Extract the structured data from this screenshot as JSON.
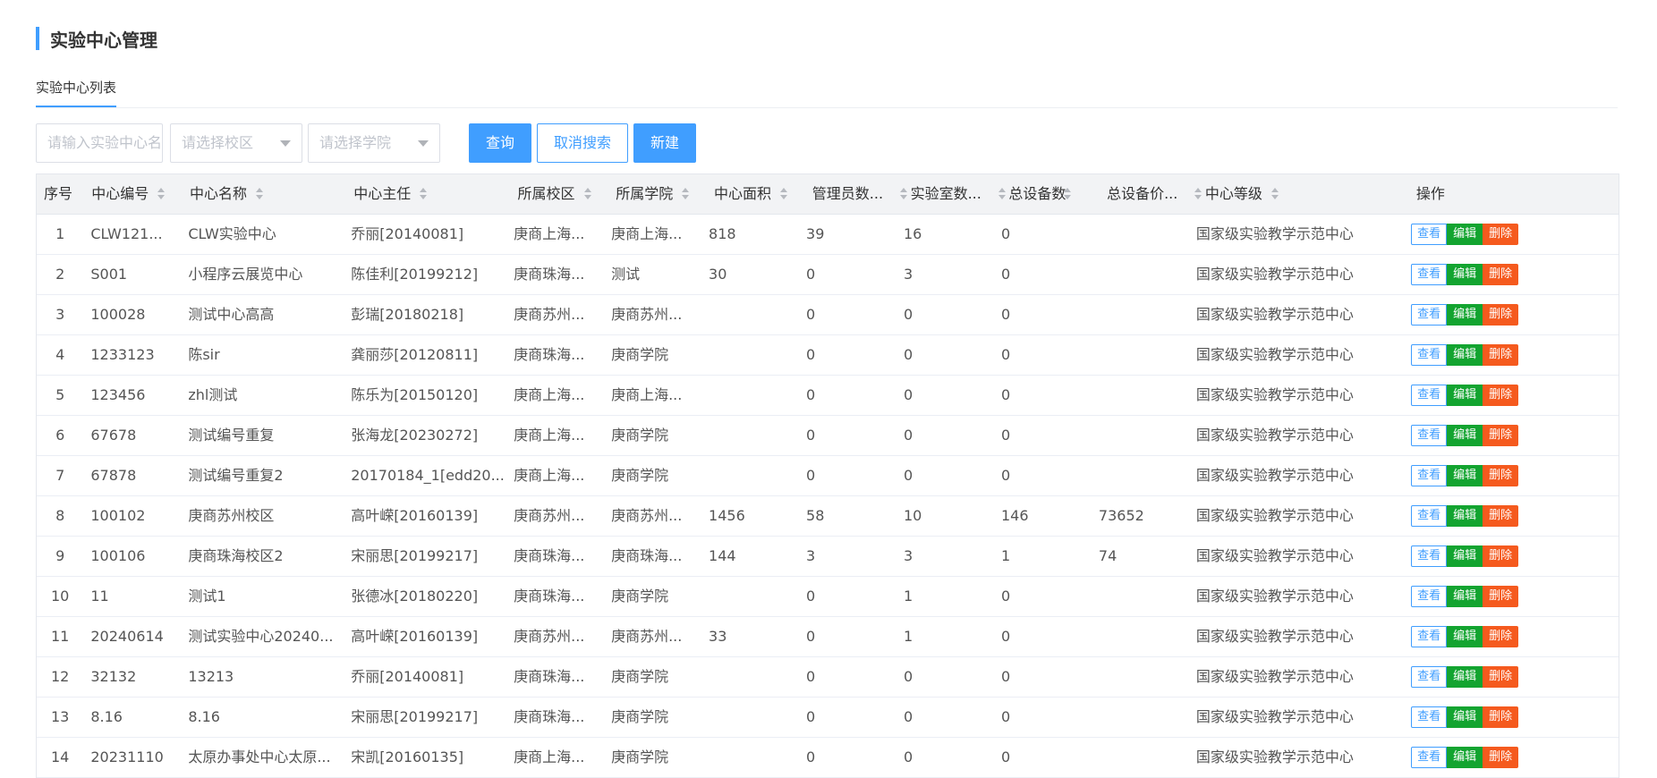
{
  "page": {
    "title": "实验中心管理"
  },
  "tabs": [
    {
      "label": "实验中心列表"
    }
  ],
  "toolbar": {
    "name_placeholder": "请输入实验中心名称",
    "campus_placeholder": "请选择校区",
    "college_placeholder": "请选择学院",
    "query_label": "查询",
    "cancel_label": "取消搜索",
    "new_label": "新建"
  },
  "table": {
    "headers": [
      "序号",
      "中心编号",
      "中心名称",
      "中心主任",
      "所属校区",
      "所属学院",
      "中心面积",
      "管理员数...",
      "实验室数...",
      "总设备数",
      "总设备价...",
      "中心等级",
      "操作"
    ],
    "action_labels": {
      "view": "查看",
      "edit": "编辑",
      "delete": "删除"
    },
    "rows": [
      [
        "1",
        "CLW121...",
        "CLW实验中心",
        "乔丽[20140081]",
        "庚商上海...",
        "庚商上海...",
        "818",
        "39",
        "16",
        "0",
        "",
        "国家级实验教学示范中心"
      ],
      [
        "2",
        "S001",
        "小程序云展览中心",
        "陈佳利[20199212]",
        "庚商珠海...",
        "测试",
        "30",
        "0",
        "3",
        "0",
        "",
        "国家级实验教学示范中心"
      ],
      [
        "3",
        "100028",
        "测试中心高高",
        "彭瑞[20180218]",
        "庚商苏州...",
        "庚商苏州...",
        "",
        "0",
        "0",
        "0",
        "",
        "国家级实验教学示范中心"
      ],
      [
        "4",
        "1233123",
        "陈sir",
        "龚丽莎[20120811]",
        "庚商珠海...",
        "庚商学院",
        "",
        "0",
        "0",
        "0",
        "",
        "国家级实验教学示范中心"
      ],
      [
        "5",
        "123456",
        "zhl测试",
        "陈乐为[20150120]",
        "庚商上海...",
        "庚商上海...",
        "",
        "0",
        "0",
        "0",
        "",
        "国家级实验教学示范中心"
      ],
      [
        "6",
        "67678",
        "测试编号重复",
        "张海龙[20230272]",
        "庚商上海...",
        "庚商学院",
        "",
        "0",
        "0",
        "0",
        "",
        "国家级实验教学示范中心"
      ],
      [
        "7",
        "67878",
        "测试编号重复2",
        "20170184_1[edd20...",
        "庚商上海...",
        "庚商学院",
        "",
        "0",
        "0",
        "0",
        "",
        "国家级实验教学示范中心"
      ],
      [
        "8",
        "100102",
        "庚商苏州校区",
        "高叶嵘[20160139]",
        "庚商苏州...",
        "庚商苏州...",
        "1456",
        "58",
        "10",
        "146",
        "73652",
        "国家级实验教学示范中心"
      ],
      [
        "9",
        "100106",
        "庚商珠海校区2",
        "宋丽思[20199217]",
        "庚商珠海...",
        "庚商珠海...",
        "144",
        "3",
        "3",
        "1",
        "74",
        "国家级实验教学示范中心"
      ],
      [
        "10",
        "11",
        "测试1",
        "张德冰[20180220]",
        "庚商珠海...",
        "庚商学院",
        "",
        "0",
        "1",
        "0",
        "",
        "国家级实验教学示范中心"
      ],
      [
        "11",
        "20240614",
        "测试实验中心20240...",
        "高叶嵘[20160139]",
        "庚商苏州...",
        "庚商苏州...",
        "33",
        "0",
        "1",
        "0",
        "",
        "国家级实验教学示范中心"
      ],
      [
        "12",
        "32132",
        "13213",
        "乔丽[20140081]",
        "庚商珠海...",
        "庚商学院",
        "",
        "0",
        "0",
        "0",
        "",
        "国家级实验教学示范中心"
      ],
      [
        "13",
        "8.16",
        "8.16",
        "宋丽思[20199217]",
        "庚商珠海...",
        "庚商学院",
        "",
        "0",
        "0",
        "0",
        "",
        "国家级实验教学示范中心"
      ],
      [
        "14",
        "20231110",
        "太原办事处中心太原...",
        "宋凯[20160135]",
        "庚商上海...",
        "庚商学院",
        "",
        "0",
        "0",
        "0",
        "",
        "国家级实验教学示范中心"
      ]
    ]
  }
}
